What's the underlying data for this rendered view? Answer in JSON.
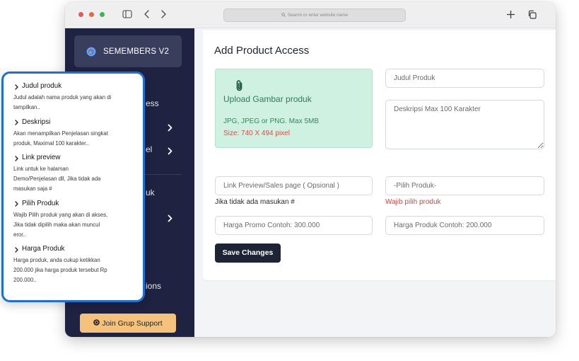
{
  "browser": {
    "address_placeholder": "Search or enter website name",
    "icons": [
      "sidebar-toggle-icon",
      "chevron-left-icon",
      "chevron-right-icon",
      "search-icon",
      "plus-icon",
      "copy-icon"
    ]
  },
  "sidebar": {
    "brand": "SEMEMBERS V2",
    "brand_icon": "compass-icon",
    "items": [
      {
        "label": "ess"
      },
      {
        "icon": "chevron-right-icon"
      },
      {
        "label": "el",
        "icon": "chevron-right-icon"
      },
      {
        "label": "uk"
      },
      {
        "icon": "chevron-right-icon"
      },
      {
        "label": "ions"
      }
    ],
    "support_button": {
      "label": "Join Grup Support",
      "icon": "support-icon"
    }
  },
  "help_panel": {
    "items": [
      {
        "title": "Judul produk",
        "description": "Judul adalah nama produk yang akan di\ntampilkan.."
      },
      {
        "title": "Deskripsi",
        "description": "Akan menampilkan Penjelasan singkat\nproduk, Maximal 100 karakter.."
      },
      {
        "title": "Link preview",
        "description": "Link untuk ke halaman\nDemo/Penjelasan dll, Jika tidak ada\nmasukan saja #"
      },
      {
        "title": "Pilih Produk",
        "description": "Wajib Pilih produk yang akan di akses,\nJika tidak dipilih maka akan muncul\neror.."
      },
      {
        "title": "Harga Produk",
        "description": "Harga produk, anda cukup ketikkan\n200.000 jika harga produk tersebut Rp\n200.000.."
      }
    ]
  },
  "form": {
    "title": "Add Product Access",
    "upload": {
      "icon": "paperclip-icon",
      "label": "Upload Gambar produk",
      "formats": "JPG, JPEG or PNG. Max 5MB",
      "size_note": "Size: 740 X 494 pixel"
    },
    "product_title": {
      "placeholder": "Judul Produk"
    },
    "description": {
      "placeholder": "Deskripsi Max 100 Karakter"
    },
    "link_preview": {
      "placeholder": "Link Preview/Sales page ( Opsional )",
      "hint": "Jika tidak ada masukan #"
    },
    "product_select": {
      "selected": "-Pilih Produk-",
      "hint": "Wajib pilih produk"
    },
    "promo_price": {
      "placeholder": "Harga Promo Contoh: 300.000"
    },
    "price": {
      "placeholder": "Harga Produk Contoh: 200.000"
    },
    "save_button": "Save Changes"
  },
  "colors": {
    "sidebar_bg": "#1f2240",
    "brand_bg": "#3a3e5d",
    "help_border": "#1b6fd5",
    "upload_bg": "#cff1e2",
    "error_red": "#e0413f",
    "support_button": "#f4c27a",
    "save_button": "#1f2435"
  }
}
